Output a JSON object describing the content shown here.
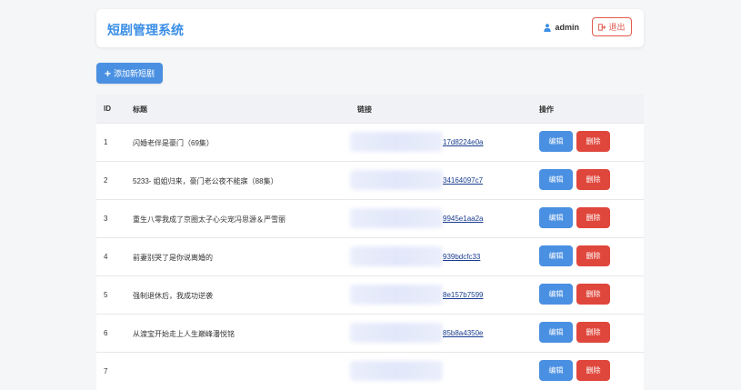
{
  "header": {
    "brand": "短剧管理系统",
    "user_icon": "user-icon",
    "username": "admin",
    "logout_icon": "sign-out-icon",
    "logout_label": "退出"
  },
  "toolbar": {
    "add_icon": "plus-icon",
    "add_label": "添加新短剧"
  },
  "table": {
    "headers": {
      "id": "ID",
      "title": "标题",
      "link": "链接",
      "ops": "操作"
    },
    "edit_label": "编辑",
    "delete_label": "删除",
    "rows": [
      {
        "id": "1",
        "title": "闪婚老伴是豪门（69集）",
        "link_visible": "17d8224e0a"
      },
      {
        "id": "2",
        "title": "5233- 姐姐归来，豪门老公夜不能寐（88集）",
        "link_visible": "34164097c7"
      },
      {
        "id": "3",
        "title": "重生八零我成了京圈太子心尖宠冯思源＆严雪丽",
        "link_visible": "9945e1aa2a"
      },
      {
        "id": "4",
        "title": "前妻别哭了是你说离婚的",
        "link_visible": "939bdcfc33"
      },
      {
        "id": "5",
        "title": "强制退休后，我成功逆袭",
        "link_visible": "8e157b7599"
      },
      {
        "id": "6",
        "title": "从渡宝开始走上人生巅峰潘悦铭",
        "link_visible": "85b8a4350e"
      },
      {
        "id": "7",
        "title": "",
        "link_visible": ""
      }
    ]
  },
  "colors": {
    "primary": "#4a90e2",
    "danger": "#e0473c",
    "brand": "#3a8ee6",
    "link": "#1a3d8f"
  }
}
